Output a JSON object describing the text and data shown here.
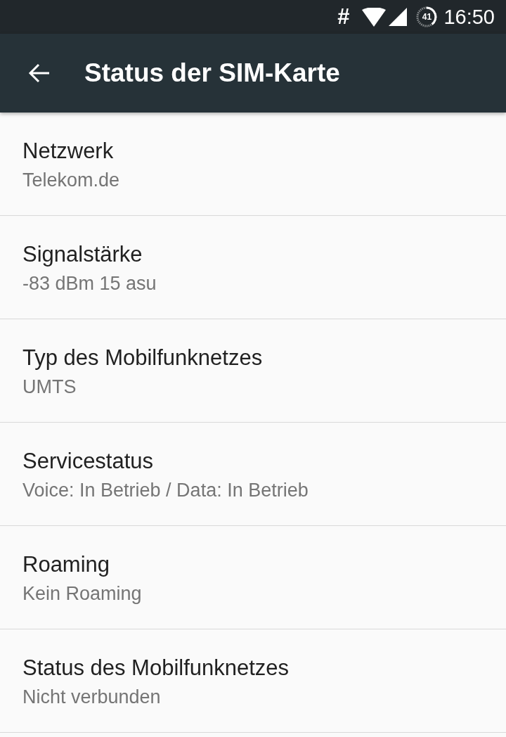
{
  "status_bar": {
    "notification_glyph": "#",
    "battery_percent": "41",
    "time": "16:50"
  },
  "app_bar": {
    "title": "Status der SIM-Karte"
  },
  "rows": [
    {
      "title": "Netzwerk",
      "value": "Telekom.de"
    },
    {
      "title": "Signalstärke",
      "value": "-83 dBm 15 asu"
    },
    {
      "title": "Typ des Mobilfunknetzes",
      "value": "UMTS"
    },
    {
      "title": "Servicestatus",
      "value": "Voice: In Betrieb / Data: In Betrieb"
    },
    {
      "title": "Roaming",
      "value": "Kein Roaming"
    },
    {
      "title": "Status des Mobilfunknetzes",
      "value": "Nicht verbunden"
    }
  ]
}
